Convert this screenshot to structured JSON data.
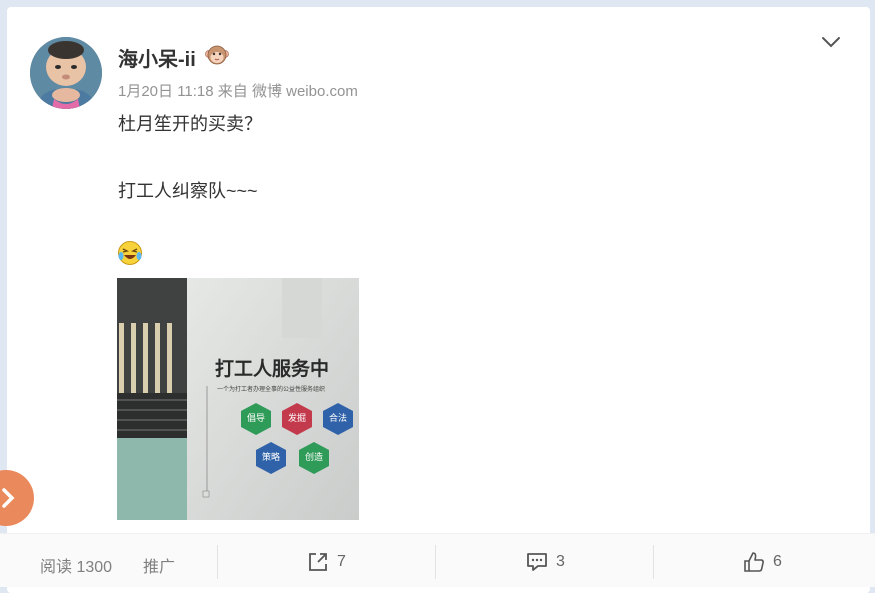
{
  "post": {
    "username": "海小呆-ii",
    "badge_icon": "monkey-face-icon",
    "meta": "1月20日 11:18 来自 微博 weibo.com",
    "lines": [
      "杜月笙开的买卖？",
      "打工人纠察队~~~"
    ],
    "emoji_icon": "laughing-crying-face-icon"
  },
  "photo": {
    "sign_title": "打工人服务中",
    "sign_subtitle": "一个为打工者办理全事的公益性服务组织",
    "hexes": [
      {
        "label": "倡导",
        "color": "#2f9b58"
      },
      {
        "label": "发掘",
        "color": "#c33a4d"
      },
      {
        "label": "合法",
        "color": "#2f62a8"
      },
      {
        "label": "策略",
        "color": "#2f62a8"
      },
      {
        "label": "创造",
        "color": "#2f9b58"
      }
    ]
  },
  "footer": {
    "read_label": "阅读 1300",
    "promote_label": "推广",
    "repost_count": "7",
    "comment_count": "3",
    "like_count": "6"
  },
  "colors": {
    "accent": "#ea8a5c",
    "text": "#333333",
    "meta": "#939393"
  }
}
